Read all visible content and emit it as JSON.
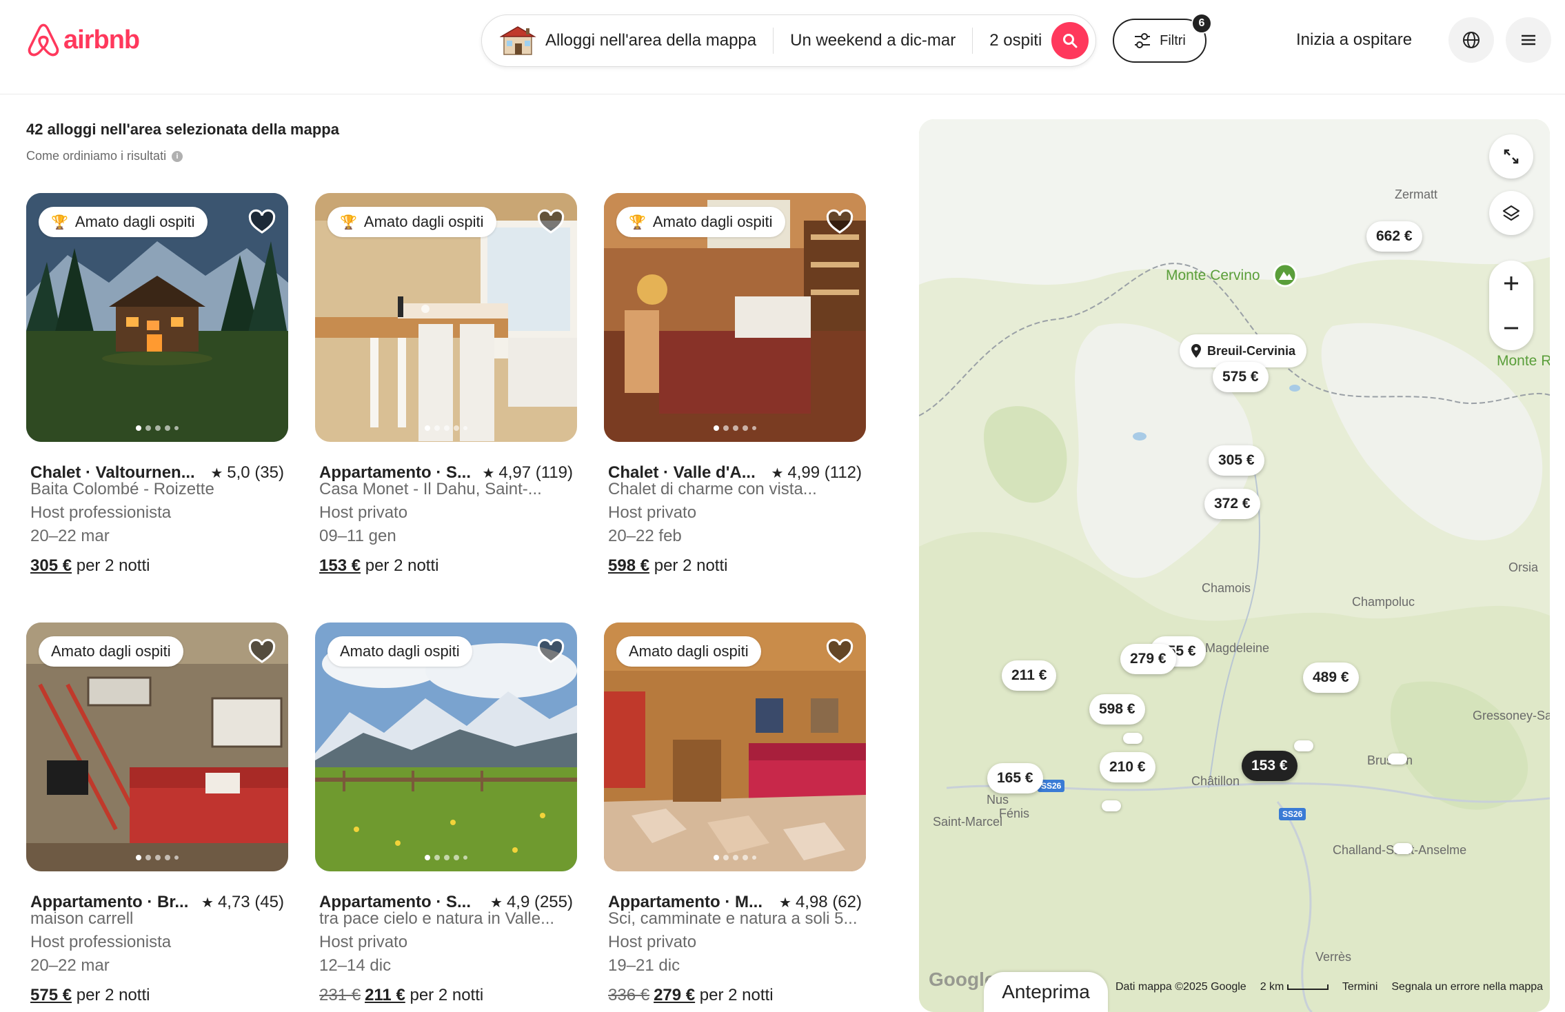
{
  "header": {
    "logo_text": "airbnb",
    "search": {
      "where": "Alloggi nell'area della mappa",
      "when": "Un weekend a dic-mar",
      "guests": "2 ospiti"
    },
    "filters_label": "Filtri",
    "filters_count": "6",
    "host_label": "Inizia a ospitare"
  },
  "results": {
    "title": "42 alloggi nell'area selezionata della mappa",
    "sort_info": "Come ordiniamo i risultati"
  },
  "listings": [
    {
      "badge": "Amato dagli ospiti",
      "type": "Chalet · Valtournen...",
      "rating": "5,0 (35)",
      "name": "Baita Colombé - Roizette",
      "host": "Host professionista",
      "dates": "20–22 mar",
      "old_price": "",
      "price": "305 €",
      "price_suffix": "per 2 notti"
    },
    {
      "badge": "Amato dagli ospiti",
      "type": "Appartamento · S...",
      "rating": "4,97 (119)",
      "name": "Casa Monet - Il Dahu, Saint-...",
      "host": "Host privato",
      "dates": "09–11 gen",
      "old_price": "",
      "price": "153 €",
      "price_suffix": "per 2 notti"
    },
    {
      "badge": "Amato dagli ospiti",
      "type": "Chalet · Valle d'A...",
      "rating": "4,99 (112)",
      "name": "Chalet di charme con vista...",
      "host": "Host privato",
      "dates": "20–22 feb",
      "old_price": "",
      "price": "598 €",
      "price_suffix": "per 2 notti"
    },
    {
      "badge": "Amato dagli ospiti",
      "type": "Appartamento · Br...",
      "rating": "4,73 (45)",
      "name": "maison carrell",
      "host": "Host professionista",
      "dates": "20–22 mar",
      "old_price": "",
      "price": "575 €",
      "price_suffix": "per 2 notti"
    },
    {
      "badge": "Amato dagli ospiti",
      "type": "Appartamento · S...",
      "rating": "4,9 (255)",
      "name": "tra pace cielo e natura in Valle...",
      "host": "Host privato",
      "dates": "12–14 dic",
      "old_price": "231 €",
      "price": "211 €",
      "price_suffix": "per 2 notti"
    },
    {
      "badge": "Amato dagli ospiti",
      "type": "Appartamento · M...",
      "rating": "4,98 (62)",
      "name": "Sci, camminate e natura a soli 5...",
      "host": "Host privato",
      "dates": "19–21 dic",
      "old_price": "336 €",
      "price": "279 €",
      "price_suffix": "per 2 notti"
    }
  ],
  "map": {
    "places": {
      "zermatt": "Zermatt",
      "monte_cervino": "Monte Cervino",
      "monte_r": "Monte R",
      "breuil_cervinia": "Breuil-Cervinia",
      "chamois": "Chamois",
      "champoluc": "Champoluc",
      "orsia": "Orsia",
      "magdeleine": "Magdeleine",
      "gressoney": "Gressoney-Sa",
      "chatillon": "Châtillon",
      "brusson": "Brusson",
      "nus": "Nus",
      "fenis": "Fénis",
      "saint_marcel": "Saint-Marcel",
      "challand": "Challand-Saint-Anselme",
      "verres": "Verrès",
      "road_1": "SS26",
      "road_2": "SS26"
    },
    "pins": {
      "p662": "662 €",
      "p575": "575 €",
      "p305": "305 €",
      "p372": "372 €",
      "p255": "255 €",
      "p279": "279 €",
      "p211": "211 €",
      "p489": "489 €",
      "p598": "598 €",
      "p210": "210 €",
      "p165": "165 €",
      "p153": "153 €"
    },
    "active_pin": "153 €",
    "google_logo": "Google",
    "preview_label": "Anteprima",
    "footer": {
      "data": "Dati mappa ©2025 Google",
      "scale": "2 km",
      "terms": "Termini",
      "report": "Segnala un errore nella mappa"
    }
  }
}
